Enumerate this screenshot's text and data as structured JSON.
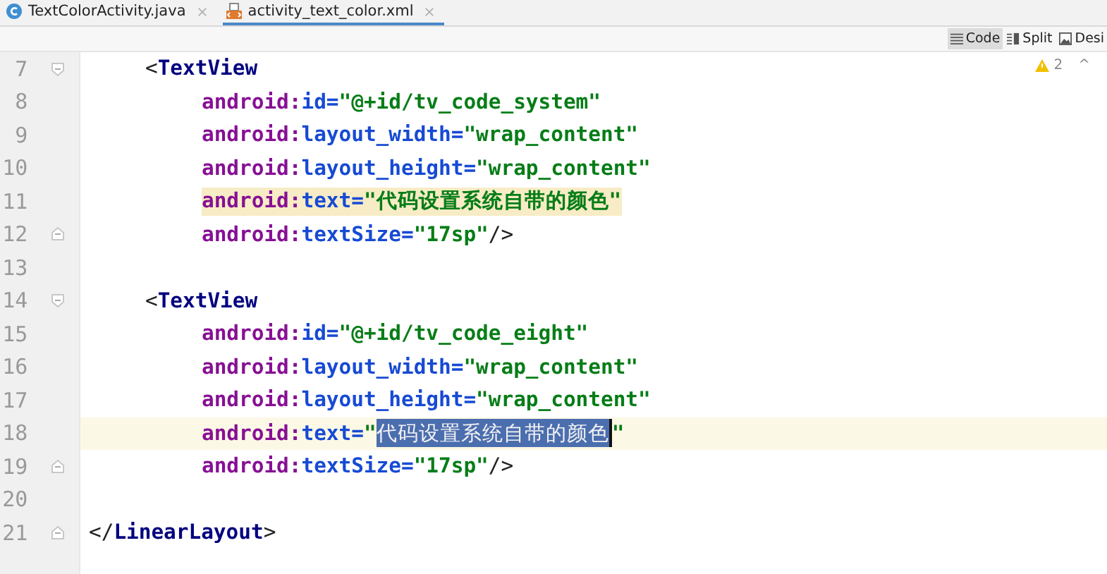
{
  "tabs": [
    {
      "label": "TextColorActivity.java",
      "kind": "java",
      "selected": false
    },
    {
      "label": "activity_text_color.xml",
      "kind": "xml",
      "selected": true
    }
  ],
  "view_modes": [
    {
      "label": "Code",
      "kind": "code",
      "selected": true
    },
    {
      "label": "Split",
      "kind": "split",
      "selected": false
    },
    {
      "label": "Desi",
      "kind": "design",
      "selected": false
    }
  ],
  "inspections": {
    "warnings": "2",
    "arrow": "^"
  },
  "code": [
    {
      "kind": "group",
      "children": [
        {
          "number": "7",
          "fold_start": true,
          "segments": [
            {
              "kind": "punct",
              "text": "<"
            },
            {
              "kind": "tag",
              "text": "TextView"
            }
          ],
          "children": [
            {
              "number": "8",
              "segments": [
                {
                  "kind": "ns",
                  "text": "android:"
                },
                {
                  "kind": "attr",
                  "text": "id="
                },
                {
                  "kind": "value",
                  "text": "\"@+id/tv_code_system\""
                }
              ]
            },
            {
              "number": "9",
              "segments": [
                {
                  "kind": "ns",
                  "text": "android:"
                },
                {
                  "kind": "attr",
                  "text": "layout_width="
                },
                {
                  "kind": "value",
                  "text": "\"wrap_content\""
                }
              ]
            },
            {
              "number": "10",
              "segments": [
                {
                  "kind": "ns",
                  "text": "android:"
                },
                {
                  "kind": "attr",
                  "text": "layout_height="
                },
                {
                  "kind": "value",
                  "text": "\"wrap_content\""
                }
              ]
            },
            {
              "number": "11",
              "highlighted": true,
              "segments": [
                {
                  "kind": "ns",
                  "text": "android:"
                },
                {
                  "kind": "attr",
                  "text": "text="
                },
                {
                  "kind": "value",
                  "text": "\"代码设置系统自带的颜色\""
                }
              ]
            },
            {
              "number": "12",
              "fold_end": true,
              "segments": [
                {
                  "kind": "ns",
                  "text": "android:"
                },
                {
                  "kind": "attr",
                  "text": "textSize="
                },
                {
                  "kind": "value",
                  "text": "\"17sp\""
                },
                {
                  "kind": "punct",
                  "text": "/>"
                }
              ]
            }
          ]
        },
        {
          "number": "13"
        },
        {
          "number": "14",
          "fold_start": true,
          "segments": [
            {
              "kind": "punct",
              "text": "<"
            },
            {
              "kind": "tag",
              "text": "TextView"
            }
          ],
          "children": [
            {
              "number": "15",
              "segments": [
                {
                  "kind": "ns",
                  "text": "android:"
                },
                {
                  "kind": "attr",
                  "text": "id="
                },
                {
                  "kind": "value",
                  "text": "\"@+id/tv_code_eight\""
                }
              ]
            },
            {
              "number": "16",
              "segments": [
                {
                  "kind": "ns",
                  "text": "android:"
                },
                {
                  "kind": "attr",
                  "text": "layout_width="
                },
                {
                  "kind": "value",
                  "text": "\"wrap_content\""
                }
              ]
            },
            {
              "number": "17",
              "segments": [
                {
                  "kind": "ns",
                  "text": "android:"
                },
                {
                  "kind": "attr",
                  "text": "layout_height="
                },
                {
                  "kind": "value",
                  "text": "\"wrap_content\""
                }
              ]
            },
            {
              "number": "18",
              "current": true,
              "segments": [
                {
                  "kind": "ns",
                  "text": "android:"
                },
                {
                  "kind": "attr",
                  "text": "text="
                },
                {
                  "kind": "value",
                  "text": "\""
                },
                {
                  "kind": "selection",
                  "text": "代码设置系统自带的颜色"
                },
                {
                  "kind": "caret"
                },
                {
                  "kind": "value",
                  "text": "\""
                }
              ]
            },
            {
              "number": "19",
              "fold_end": true,
              "segments": [
                {
                  "kind": "ns",
                  "text": "android:"
                },
                {
                  "kind": "attr",
                  "text": "textSize="
                },
                {
                  "kind": "value",
                  "text": "\"17sp\""
                },
                {
                  "kind": "punct",
                  "text": "/>"
                }
              ]
            }
          ]
        },
        {
          "number": "20"
        }
      ]
    },
    {
      "number": "21",
      "fold_end": true,
      "segments": [
        {
          "kind": "punct",
          "text": "</"
        },
        {
          "kind": "tag",
          "text": "LinearLayout"
        },
        {
          "kind": "punct",
          "text": ">"
        }
      ]
    }
  ]
}
